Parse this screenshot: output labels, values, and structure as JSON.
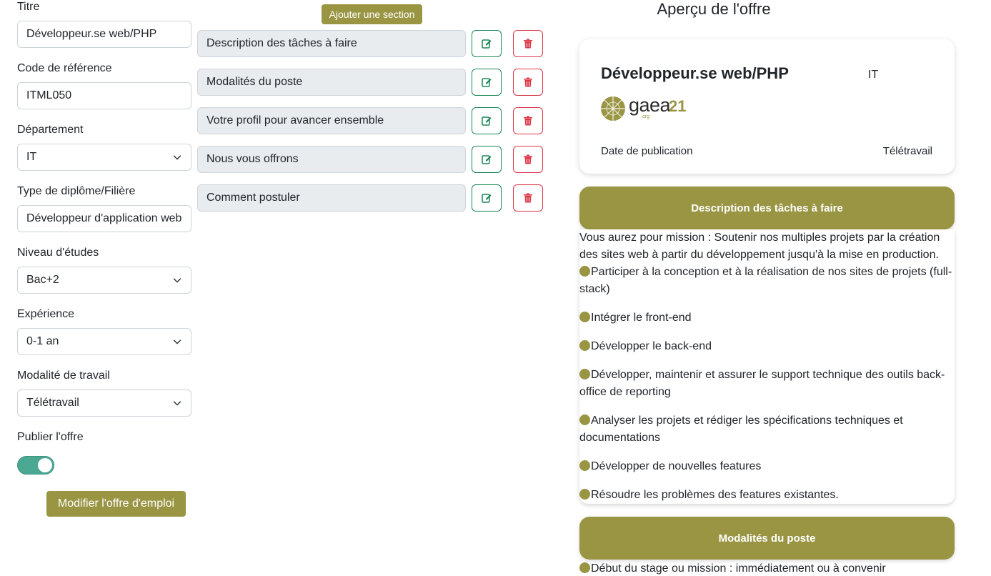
{
  "form": {
    "title_label": "Titre",
    "title_value": "Développeur.se web/PHP",
    "ref_label": "Code de référence",
    "ref_value": "ITML050",
    "dept_label": "Département",
    "dept_value": "IT",
    "diploma_label": "Type de diplôme/Filière",
    "diploma_value": "Développeur d'application web",
    "level_label": "Niveau d'études",
    "level_value": "Bac+2",
    "experience_label": "Expérience",
    "experience_value": "0-1 an",
    "work_mode_label": "Modalité de travail",
    "work_mode_value": "Télétravail",
    "publish_label": "Publier l'offre",
    "publish_on": true,
    "submit_label": "Modifier l'offre d'emploi"
  },
  "sections_editor": {
    "add_label": "Ajouter une section",
    "items": [
      {
        "name": "Description des tâches à faire"
      },
      {
        "name": "Modalités du poste"
      },
      {
        "name": "Votre profil pour avancer ensemble"
      },
      {
        "name": "Nous vous offrons"
      },
      {
        "name": "Comment postuler"
      }
    ]
  },
  "preview": {
    "heading": "Aperçu de l'offre",
    "job_title": "Développeur.se web/PHP",
    "department": "IT",
    "logo_word": "gaea",
    "logo_number": "21",
    "logo_org": ".org",
    "date_label": "Date de publication",
    "work_mode": "Télétravail",
    "section1": {
      "header": "Description des tâches à faire",
      "intro": "Vous aurez pour mission : Soutenir nos multiples projets par la création des sites web à partir du développement jusqu'à la mise en production.",
      "bullets": [
        "Participer à la conception et à la réalisation de nos sites de projets (full-stack)",
        "Intégrer le front-end",
        "Développer le back-end",
        "Développer, maintenir et assurer le support technique des outils back-office de reporting",
        "Analyser les projets et rédiger les spécifications techniques et documentations",
        "Développer de nouvelles features",
        "Résoudre les problèmes des features existantes."
      ]
    },
    "section2": {
      "header": "Modalités du poste",
      "bullets": [
        "Début du stage ou mission : immédiatement ou à convenir"
      ]
    }
  },
  "colors": {
    "accent": "#999543",
    "toggle_on": "#4aa893",
    "edit": "#198754",
    "delete": "#dc3545"
  }
}
